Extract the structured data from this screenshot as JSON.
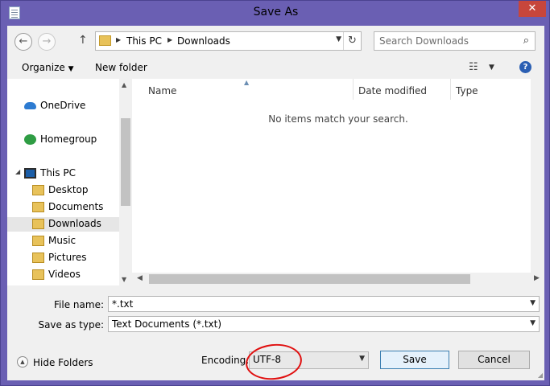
{
  "window": {
    "title": "Save As",
    "close_glyph": "✕"
  },
  "address": {
    "segments": [
      "This PC",
      "Downloads"
    ]
  },
  "search": {
    "placeholder": "Search Downloads"
  },
  "toolbar": {
    "organize_label": "Organize",
    "new_folder_label": "New folder"
  },
  "nav": {
    "items": [
      {
        "label": "OneDrive",
        "icon": "onedrive-icon"
      },
      {
        "label": "Homegroup",
        "icon": "homegroup-icon"
      },
      {
        "label": "This PC",
        "icon": "this-pc-icon"
      },
      {
        "label": "Desktop",
        "icon": "folder-icon"
      },
      {
        "label": "Documents",
        "icon": "folder-icon"
      },
      {
        "label": "Downloads",
        "icon": "folder-icon"
      },
      {
        "label": "Music",
        "icon": "folder-icon"
      },
      {
        "label": "Pictures",
        "icon": "folder-icon"
      },
      {
        "label": "Videos",
        "icon": "folder-icon"
      }
    ],
    "selected": "Downloads"
  },
  "filelist": {
    "columns": [
      "Name",
      "Date modified",
      "Type"
    ],
    "empty_message": "No items match your search."
  },
  "form": {
    "file_name_label": "File name:",
    "file_name_value": "*.txt",
    "save_type_label": "Save as type:",
    "save_type_value": "Text Documents (*.txt)",
    "encoding_label": "Encoding:",
    "encoding_value": "UTF-8"
  },
  "footer": {
    "hide_folders_label": "Hide Folders",
    "save_label": "Save",
    "cancel_label": "Cancel"
  },
  "colors": {
    "window_frame": "#6a5fb3",
    "close_button": "#c7463c",
    "annotation": "#e01010",
    "selection": "#e6e6e6"
  }
}
